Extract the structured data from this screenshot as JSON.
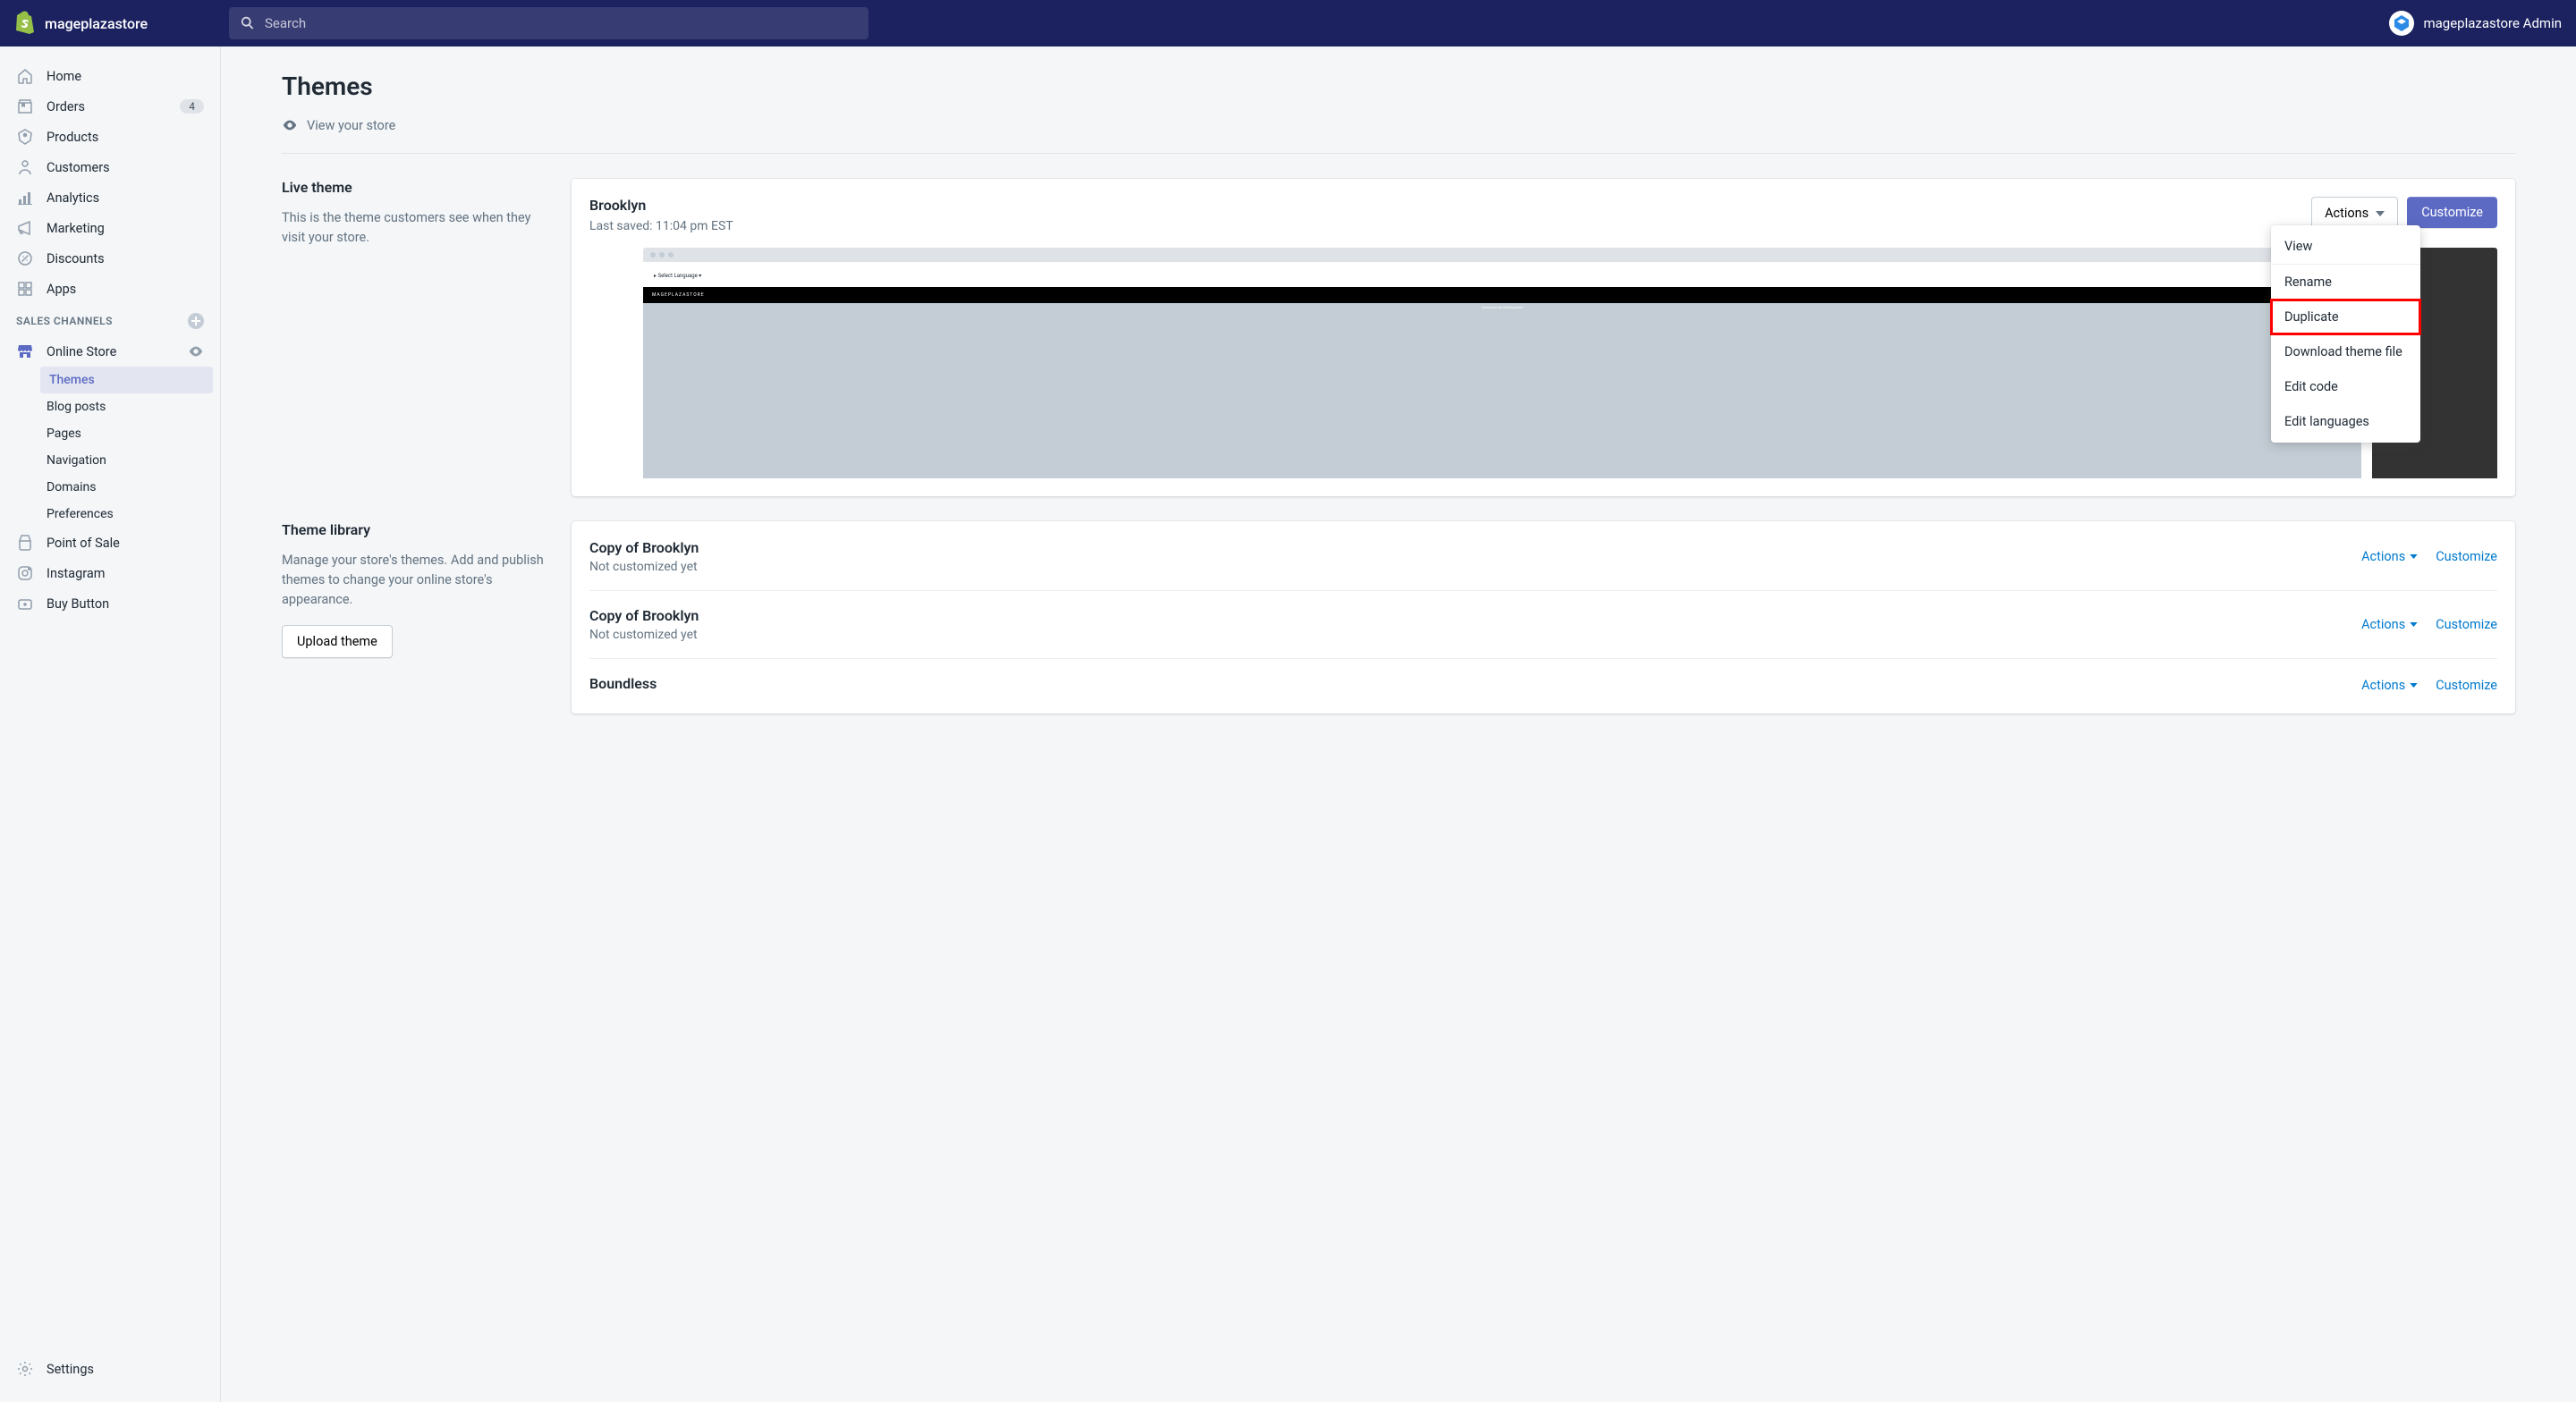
{
  "topbar": {
    "store_name": "mageplazastore",
    "search_placeholder": "Search",
    "admin_name": "mageplazastore Admin"
  },
  "sidebar": {
    "main_nav": [
      {
        "label": "Home",
        "icon": "home"
      },
      {
        "label": "Orders",
        "icon": "orders",
        "badge": "4"
      },
      {
        "label": "Products",
        "icon": "products"
      },
      {
        "label": "Customers",
        "icon": "customers"
      },
      {
        "label": "Analytics",
        "icon": "analytics"
      },
      {
        "label": "Marketing",
        "icon": "marketing"
      },
      {
        "label": "Discounts",
        "icon": "discounts"
      },
      {
        "label": "Apps",
        "icon": "apps"
      }
    ],
    "section_header": "SALES CHANNELS",
    "channel": {
      "label": "Online Store",
      "icon": "store"
    },
    "sub_nav": [
      {
        "label": "Themes",
        "active": true
      },
      {
        "label": "Blog posts"
      },
      {
        "label": "Pages"
      },
      {
        "label": "Navigation"
      },
      {
        "label": "Domains"
      },
      {
        "label": "Preferences"
      }
    ],
    "extra_nav": [
      {
        "label": "Point of Sale",
        "icon": "pos"
      },
      {
        "label": "Instagram",
        "icon": "instagram"
      },
      {
        "label": "Buy Button",
        "icon": "buy"
      }
    ],
    "settings_label": "Settings"
  },
  "page": {
    "title": "Themes",
    "view_store": "View your store"
  },
  "live_theme": {
    "heading": "Live theme",
    "description": "This is the theme customers see when they visit your store.",
    "name": "Brooklyn",
    "last_saved": "Last saved: 11:04 pm EST",
    "actions_label": "Actions",
    "customize_label": "Customize",
    "preview_store_name": "MAGEPLAZASTORE"
  },
  "dropdown_items": [
    {
      "label": "View"
    },
    {
      "label": "Rename"
    },
    {
      "label": "Duplicate",
      "highlighted": true
    },
    {
      "label": "Download theme file"
    },
    {
      "label": "Edit code"
    },
    {
      "label": "Edit languages"
    }
  ],
  "library": {
    "heading": "Theme library",
    "description": "Manage your store's themes. Add and publish themes to change your online store's appearance.",
    "upload_label": "Upload theme",
    "items": [
      {
        "name": "Copy of Brooklyn",
        "status": "Not customized yet",
        "actions": "Actions",
        "customize": "Customize"
      },
      {
        "name": "Copy of Brooklyn",
        "status": "Not customized yet",
        "actions": "Actions",
        "customize": "Customize"
      },
      {
        "name": "Boundless",
        "status": "",
        "actions": "Actions",
        "customize": "Customize"
      }
    ]
  }
}
